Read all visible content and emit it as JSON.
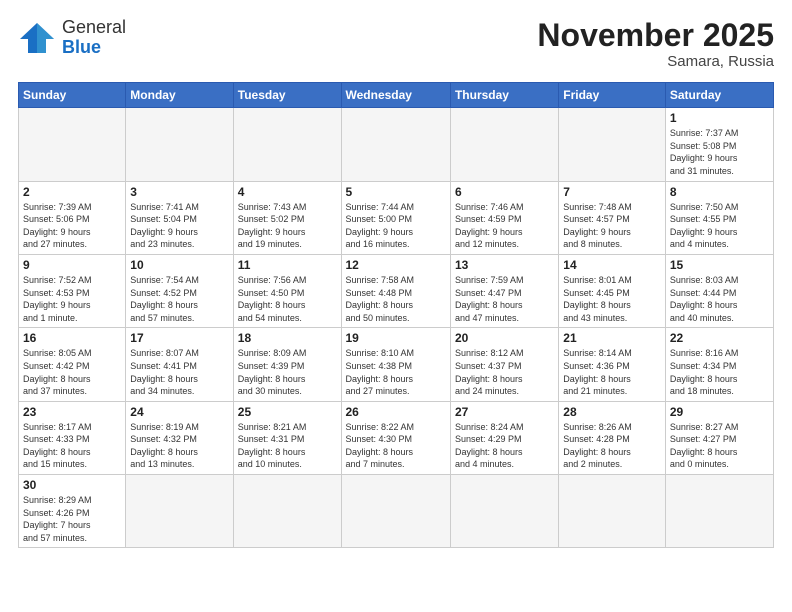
{
  "logo": {
    "general": "General",
    "blue": "Blue"
  },
  "title": "November 2025",
  "location": "Samara, Russia",
  "days_of_week": [
    "Sunday",
    "Monday",
    "Tuesday",
    "Wednesday",
    "Thursday",
    "Friday",
    "Saturday"
  ],
  "weeks": [
    [
      {
        "day": "",
        "info": ""
      },
      {
        "day": "",
        "info": ""
      },
      {
        "day": "",
        "info": ""
      },
      {
        "day": "",
        "info": ""
      },
      {
        "day": "",
        "info": ""
      },
      {
        "day": "",
        "info": ""
      },
      {
        "day": "1",
        "info": "Sunrise: 7:37 AM\nSunset: 5:08 PM\nDaylight: 9 hours\nand 31 minutes."
      }
    ],
    [
      {
        "day": "2",
        "info": "Sunrise: 7:39 AM\nSunset: 5:06 PM\nDaylight: 9 hours\nand 27 minutes."
      },
      {
        "day": "3",
        "info": "Sunrise: 7:41 AM\nSunset: 5:04 PM\nDaylight: 9 hours\nand 23 minutes."
      },
      {
        "day": "4",
        "info": "Sunrise: 7:43 AM\nSunset: 5:02 PM\nDaylight: 9 hours\nand 19 minutes."
      },
      {
        "day": "5",
        "info": "Sunrise: 7:44 AM\nSunset: 5:00 PM\nDaylight: 9 hours\nand 16 minutes."
      },
      {
        "day": "6",
        "info": "Sunrise: 7:46 AM\nSunset: 4:59 PM\nDaylight: 9 hours\nand 12 minutes."
      },
      {
        "day": "7",
        "info": "Sunrise: 7:48 AM\nSunset: 4:57 PM\nDaylight: 9 hours\nand 8 minutes."
      },
      {
        "day": "8",
        "info": "Sunrise: 7:50 AM\nSunset: 4:55 PM\nDaylight: 9 hours\nand 4 minutes."
      }
    ],
    [
      {
        "day": "9",
        "info": "Sunrise: 7:52 AM\nSunset: 4:53 PM\nDaylight: 9 hours\nand 1 minute."
      },
      {
        "day": "10",
        "info": "Sunrise: 7:54 AM\nSunset: 4:52 PM\nDaylight: 8 hours\nand 57 minutes."
      },
      {
        "day": "11",
        "info": "Sunrise: 7:56 AM\nSunset: 4:50 PM\nDaylight: 8 hours\nand 54 minutes."
      },
      {
        "day": "12",
        "info": "Sunrise: 7:58 AM\nSunset: 4:48 PM\nDaylight: 8 hours\nand 50 minutes."
      },
      {
        "day": "13",
        "info": "Sunrise: 7:59 AM\nSunset: 4:47 PM\nDaylight: 8 hours\nand 47 minutes."
      },
      {
        "day": "14",
        "info": "Sunrise: 8:01 AM\nSunset: 4:45 PM\nDaylight: 8 hours\nand 43 minutes."
      },
      {
        "day": "15",
        "info": "Sunrise: 8:03 AM\nSunset: 4:44 PM\nDaylight: 8 hours\nand 40 minutes."
      }
    ],
    [
      {
        "day": "16",
        "info": "Sunrise: 8:05 AM\nSunset: 4:42 PM\nDaylight: 8 hours\nand 37 minutes."
      },
      {
        "day": "17",
        "info": "Sunrise: 8:07 AM\nSunset: 4:41 PM\nDaylight: 8 hours\nand 34 minutes."
      },
      {
        "day": "18",
        "info": "Sunrise: 8:09 AM\nSunset: 4:39 PM\nDaylight: 8 hours\nand 30 minutes."
      },
      {
        "day": "19",
        "info": "Sunrise: 8:10 AM\nSunset: 4:38 PM\nDaylight: 8 hours\nand 27 minutes."
      },
      {
        "day": "20",
        "info": "Sunrise: 8:12 AM\nSunset: 4:37 PM\nDaylight: 8 hours\nand 24 minutes."
      },
      {
        "day": "21",
        "info": "Sunrise: 8:14 AM\nSunset: 4:36 PM\nDaylight: 8 hours\nand 21 minutes."
      },
      {
        "day": "22",
        "info": "Sunrise: 8:16 AM\nSunset: 4:34 PM\nDaylight: 8 hours\nand 18 minutes."
      }
    ],
    [
      {
        "day": "23",
        "info": "Sunrise: 8:17 AM\nSunset: 4:33 PM\nDaylight: 8 hours\nand 15 minutes."
      },
      {
        "day": "24",
        "info": "Sunrise: 8:19 AM\nSunset: 4:32 PM\nDaylight: 8 hours\nand 13 minutes."
      },
      {
        "day": "25",
        "info": "Sunrise: 8:21 AM\nSunset: 4:31 PM\nDaylight: 8 hours\nand 10 minutes."
      },
      {
        "day": "26",
        "info": "Sunrise: 8:22 AM\nSunset: 4:30 PM\nDaylight: 8 hours\nand 7 minutes."
      },
      {
        "day": "27",
        "info": "Sunrise: 8:24 AM\nSunset: 4:29 PM\nDaylight: 8 hours\nand 4 minutes."
      },
      {
        "day": "28",
        "info": "Sunrise: 8:26 AM\nSunset: 4:28 PM\nDaylight: 8 hours\nand 2 minutes."
      },
      {
        "day": "29",
        "info": "Sunrise: 8:27 AM\nSunset: 4:27 PM\nDaylight: 8 hours\nand 0 minutes."
      }
    ],
    [
      {
        "day": "30",
        "info": "Sunrise: 8:29 AM\nSunset: 4:26 PM\nDaylight: 7 hours\nand 57 minutes."
      },
      {
        "day": "",
        "info": ""
      },
      {
        "day": "",
        "info": ""
      },
      {
        "day": "",
        "info": ""
      },
      {
        "day": "",
        "info": ""
      },
      {
        "day": "",
        "info": ""
      },
      {
        "day": "",
        "info": ""
      }
    ]
  ]
}
